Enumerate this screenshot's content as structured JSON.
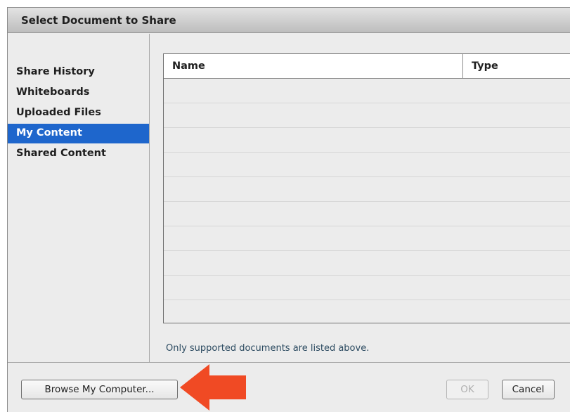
{
  "dialog": {
    "title": "Select Document to Share"
  },
  "sidebar": {
    "items": [
      {
        "label": "Share History"
      },
      {
        "label": "Whiteboards"
      },
      {
        "label": "Uploaded Files"
      },
      {
        "label": "My Content",
        "selected": true
      },
      {
        "label": "Shared Content"
      }
    ]
  },
  "table": {
    "columns": [
      "Name",
      "Type"
    ],
    "rows": []
  },
  "note": "Only supported documents are listed above.",
  "footer": {
    "browse_label": "Browse My Computer...",
    "ok_label": "OK",
    "ok_enabled": false,
    "cancel_label": "Cancel"
  },
  "colors": {
    "selection": "#1e66cc",
    "annotation_arrow": "#f04a24"
  },
  "annotation": {
    "icon": "left-arrow-icon"
  }
}
